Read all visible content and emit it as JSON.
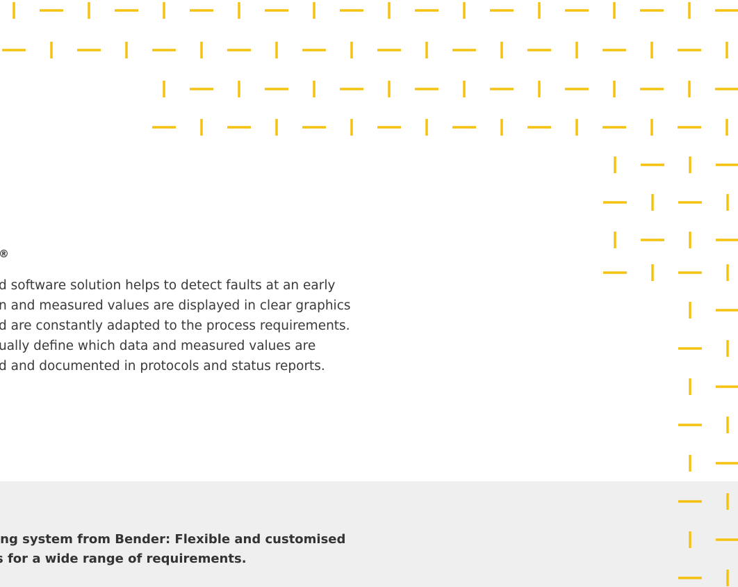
{
  "colors": {
    "accent": "#f5c211",
    "text": "#3a3a3a",
    "band": "#efefef"
  },
  "registered_mark": "®",
  "paragraph": {
    "lines": [
      "d software solution helps to detect faults at an early",
      "n and measured values are displayed in clear graphics",
      "d are constantly adapted to the process requirements.",
      "ually define which data and measured values are",
      "d and documented in protocols and status reports."
    ]
  },
  "caption": {
    "lines": [
      "ing system from Bender: Flexible and customised",
      "s for a wide range of requirements."
    ]
  }
}
